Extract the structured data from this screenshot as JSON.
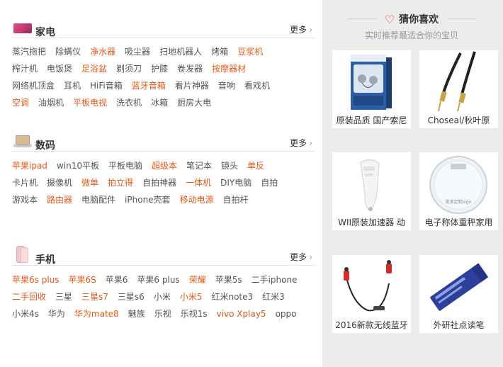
{
  "sections": [
    {
      "title": "家电",
      "more": "更多",
      "rows": [
        [
          {
            "t": "蒸汽拖把",
            "h": false
          },
          {
            "t": "除螨仪",
            "h": false
          },
          {
            "t": "净水器",
            "h": true
          },
          {
            "t": "吸尘器",
            "h": false
          },
          {
            "t": "扫地机器人",
            "h": false
          },
          {
            "t": "烤箱",
            "h": false
          },
          {
            "t": "豆浆机",
            "h": true
          }
        ],
        [
          {
            "t": "榨汁机",
            "h": false
          },
          {
            "t": "电饭煲",
            "h": false
          },
          {
            "t": "足浴盆",
            "h": true
          },
          {
            "t": "剃须刀",
            "h": false
          },
          {
            "t": "护膝",
            "h": false
          },
          {
            "t": "卷发器",
            "h": false
          },
          {
            "t": "按摩器材",
            "h": true
          }
        ],
        [
          {
            "t": "网络机顶盒",
            "h": false
          },
          {
            "t": "耳机",
            "h": false
          },
          {
            "t": "HiFi音箱",
            "h": false
          },
          {
            "t": "蓝牙音箱",
            "h": true
          },
          {
            "t": "看片神器",
            "h": false
          },
          {
            "t": "音响",
            "h": false
          },
          {
            "t": "看戏机",
            "h": false
          }
        ],
        [
          {
            "t": "空调",
            "h": true
          },
          {
            "t": "油烟机",
            "h": false
          },
          {
            "t": "平板电视",
            "h": true
          },
          {
            "t": "洗衣机",
            "h": false
          },
          {
            "t": "冰箱",
            "h": false
          },
          {
            "t": "厨房大电",
            "h": false
          }
        ]
      ]
    },
    {
      "title": "数码",
      "more": "更多",
      "rows": [
        [
          {
            "t": "苹果ipad",
            "h": true
          },
          {
            "t": "win10平板",
            "h": false
          },
          {
            "t": "平板电脑",
            "h": false
          },
          {
            "t": "超级本",
            "h": true
          },
          {
            "t": "笔记本",
            "h": false
          },
          {
            "t": "镜头",
            "h": false
          },
          {
            "t": "单反",
            "h": true
          }
        ],
        [
          {
            "t": "卡片机",
            "h": false
          },
          {
            "t": "摄像机",
            "h": false
          },
          {
            "t": "微单",
            "h": true
          },
          {
            "t": "拍立得",
            "h": true
          },
          {
            "t": "自拍神器",
            "h": false
          },
          {
            "t": "一体机",
            "h": true
          },
          {
            "t": "DIY电脑",
            "h": false
          },
          {
            "t": "自拍",
            "h": false
          }
        ],
        [
          {
            "t": "游戏本",
            "h": false
          },
          {
            "t": "路由器",
            "h": true
          },
          {
            "t": "电脑配件",
            "h": false
          },
          {
            "t": "iPhone壳套",
            "h": false
          },
          {
            "t": "移动电源",
            "h": true
          },
          {
            "t": "自拍杆",
            "h": false
          }
        ]
      ]
    },
    {
      "title": "手机",
      "more": "更多",
      "rows": [
        [
          {
            "t": "苹果6s plus",
            "h": true
          },
          {
            "t": "苹果6S",
            "h": true
          },
          {
            "t": "苹果6",
            "h": false
          },
          {
            "t": "苹果6 plus",
            "h": false
          },
          {
            "t": "荣耀",
            "h": true
          },
          {
            "t": "苹果5s",
            "h": false
          },
          {
            "t": "二手iphone",
            "h": false
          }
        ],
        [
          {
            "t": "二手回收",
            "h": true
          },
          {
            "t": "三星",
            "h": false
          },
          {
            "t": "三星s7",
            "h": true
          },
          {
            "t": "三星s6",
            "h": false
          },
          {
            "t": "小米",
            "h": false
          },
          {
            "t": "小米5",
            "h": true
          },
          {
            "t": "红米note3",
            "h": false
          },
          {
            "t": "红米3",
            "h": false
          }
        ],
        [
          {
            "t": "小米4s",
            "h": false
          },
          {
            "t": "华为",
            "h": false
          },
          {
            "t": "华为mate8",
            "h": true
          },
          {
            "t": "魅族",
            "h": false
          },
          {
            "t": "乐视",
            "h": false
          },
          {
            "t": "乐视1s",
            "h": false
          },
          {
            "t": "vivo Xplay5",
            "h": true
          },
          {
            "t": "oppo",
            "h": false
          }
        ]
      ]
    }
  ],
  "guess": {
    "title": "猜你喜欢",
    "subtitle": "实时推荐最适合你的宝贝",
    "heart_icon": "heart-icon",
    "items": [
      {
        "caption": "原装品质 国产索尼",
        "icon": "earphone-box-icon"
      },
      {
        "caption": "Choseal/秋叶原",
        "icon": "audio-cable-icon"
      },
      {
        "caption": "WII原装加速器 动",
        "icon": "wii-controller-icon"
      },
      {
        "caption": "电子称体重秤家用",
        "icon": "bathroom-scale-icon"
      },
      {
        "caption": "2016新款无线蓝牙",
        "icon": "bluetooth-earphone-icon"
      },
      {
        "caption": "外研社点读笔",
        "icon": "reading-pen-icon"
      }
    ]
  },
  "colors": {
    "hot": "#e4591a",
    "normal": "#555555",
    "panel_bg": "#ececec",
    "heart": "#e4391a"
  }
}
